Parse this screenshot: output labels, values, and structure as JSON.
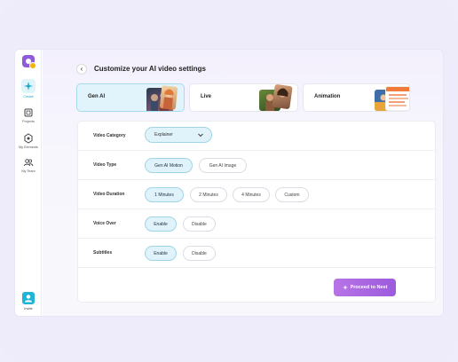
{
  "sidebar": {
    "items": [
      {
        "label": "Create",
        "icon": "sparkle-icon"
      },
      {
        "label": "Projects",
        "icon": "projects-icon"
      },
      {
        "label": "My Elements",
        "icon": "elements-icon"
      },
      {
        "label": "My Team",
        "icon": "team-icon"
      }
    ],
    "invite_label": "Invite"
  },
  "header": {
    "title": "Customize your AI video settings"
  },
  "styles": [
    {
      "label": "Gen AI",
      "selected": true
    },
    {
      "label": "Live",
      "selected": false
    },
    {
      "label": "Animation",
      "selected": false
    }
  ],
  "settings": {
    "category": {
      "label": "Video Category",
      "value": "Explainer"
    },
    "type": {
      "label": "Video Type",
      "options": [
        "Gen AI Motion",
        "Gen AI Image"
      ],
      "selected": "Gen AI Motion"
    },
    "duration": {
      "label": "Video Duration",
      "options": [
        "1 Minutes",
        "2 Minutes",
        "4 Minutes",
        "Custom"
      ],
      "selected": "1 Minutes"
    },
    "voice": {
      "label": "Voice Over",
      "options": [
        "Enable",
        "Disable"
      ],
      "selected": "Enable"
    },
    "subtitles": {
      "label": "Subtitles",
      "options": [
        "Enable",
        "Disable"
      ],
      "selected": "Enable"
    }
  },
  "actions": {
    "proceed_label": "Proceed to Next"
  },
  "colors": {
    "accent": "#1aa8c4",
    "selected_bg": "#e0f3fa",
    "proceed": "#a866e0",
    "brand": "#8e5bd9"
  }
}
